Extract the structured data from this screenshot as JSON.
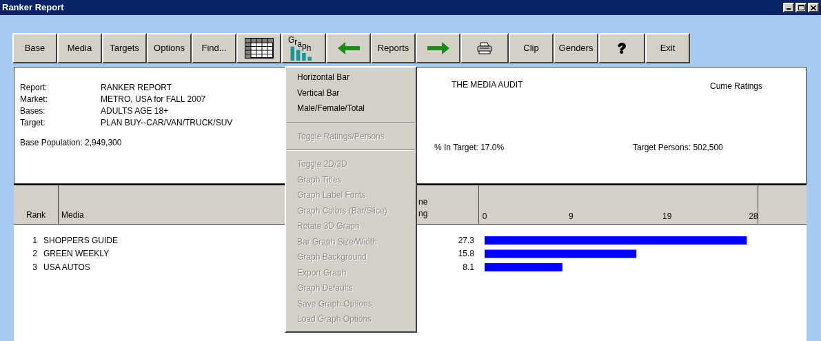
{
  "window": {
    "title": "Ranker Report"
  },
  "toolbar": [
    {
      "kind": "text",
      "label": "Base"
    },
    {
      "kind": "text",
      "label": "Media"
    },
    {
      "kind": "text",
      "label": "Targets"
    },
    {
      "kind": "text",
      "label": "Options"
    },
    {
      "kind": "text",
      "label": "Find..."
    },
    {
      "kind": "grid"
    },
    {
      "kind": "graph",
      "label": "Graph"
    },
    {
      "kind": "back"
    },
    {
      "kind": "text",
      "label": "Reports"
    },
    {
      "kind": "forward"
    },
    {
      "kind": "print"
    },
    {
      "kind": "text",
      "label": "Clip"
    },
    {
      "kind": "text",
      "label": "Genders"
    },
    {
      "kind": "help",
      "label": "?"
    },
    {
      "kind": "text",
      "label": "Exit"
    }
  ],
  "report_info": {
    "fields": [
      {
        "label": "Report:",
        "value": "RANKER REPORT"
      },
      {
        "label": "Market:",
        "value": "METRO, USA for FALL 2007"
      },
      {
        "label": "Bases:",
        "value": "ADULTS AGE 18+"
      },
      {
        "label": "Target:",
        "value": "PLAN BUY--CAR/VAN/TRUCK/SUV"
      }
    ],
    "base_population": "Base Population: 2,949,300",
    "source": "THE MEDIA AUDIT",
    "measure": "Cume Ratings",
    "in_target": "% In Target: 17.0%",
    "target_persons": "Target Persons: 502,500"
  },
  "table": {
    "columns": [
      {
        "label": "Rank"
      },
      {
        "label": "Media"
      },
      {
        "lines": [
          "ne",
          "ng"
        ]
      }
    ],
    "rows": [
      {
        "rank": "1",
        "media": "SHOPPERS GUIDE",
        "value": "27.3"
      },
      {
        "rank": "2",
        "media": "GREEN WEEKLY",
        "value": "15.8"
      },
      {
        "rank": "3",
        "media": "USA AUTOS",
        "value": "8.1"
      }
    ],
    "chart_data": {
      "type": "bar",
      "orientation": "horizontal",
      "series": [
        {
          "color": "#0000ff",
          "values": [
            27.3,
            15.8,
            8.1
          ]
        }
      ],
      "xlim": [
        0,
        28.5
      ],
      "xticks": [
        0,
        9,
        19,
        28
      ]
    }
  },
  "graph_menu": {
    "items": [
      {
        "kind": "item",
        "label": "Horizontal Bar",
        "disabled": false
      },
      {
        "kind": "item",
        "label": "Vertical Bar",
        "disabled": false
      },
      {
        "kind": "item",
        "label": "Male/Female/Total",
        "disabled": false
      },
      {
        "kind": "separator"
      },
      {
        "kind": "item",
        "label": "Toggle Ratings/Persons",
        "disabled": true
      },
      {
        "kind": "separator"
      },
      {
        "kind": "item",
        "label": "Toggle 2D/3D",
        "disabled": true
      },
      {
        "kind": "item",
        "label": "Graph Titles",
        "disabled": true
      },
      {
        "kind": "item",
        "label": "Graph Label Fonts",
        "disabled": true
      },
      {
        "kind": "item",
        "label": "Graph Colors (Bar/Slice)",
        "disabled": true
      },
      {
        "kind": "item",
        "label": "Rotate 3D Graph",
        "disabled": true
      },
      {
        "kind": "item",
        "label": "Bar Graph Size/Width",
        "disabled": true
      },
      {
        "kind": "item",
        "label": "Graph Background",
        "disabled": true
      },
      {
        "kind": "item",
        "label": "Export Graph",
        "disabled": true
      },
      {
        "kind": "item",
        "label": "Graph Defaults",
        "disabled": true
      },
      {
        "kind": "item",
        "label": "Save Graph Options",
        "disabled": true
      },
      {
        "kind": "item",
        "label": "Load Graph Options",
        "disabled": true
      }
    ]
  }
}
